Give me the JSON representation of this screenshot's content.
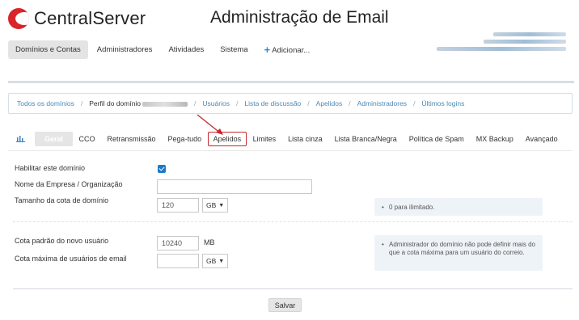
{
  "header": {
    "logo_text": "CentralServer",
    "page_title": "Administração de Email"
  },
  "topnav": {
    "items": [
      {
        "label": "Domínios e Contas",
        "active": true
      },
      {
        "label": "Administradores"
      },
      {
        "label": "Atividades"
      },
      {
        "label": "Sistema"
      },
      {
        "label": "Adicionar...",
        "icon": "plus-icon"
      }
    ]
  },
  "breadcrumb": {
    "items": [
      "Todos os domínios",
      "Perfil do domínio",
      "Usuários",
      "Lista de discussão",
      "Apelidos",
      "Administradores",
      "Últimos logins"
    ]
  },
  "tabs": {
    "chart_icon": "bar-chart-icon",
    "items": [
      "Geral",
      "CCO",
      "Retransmissão",
      "Pega-tudo",
      "Apelidos",
      "Limites",
      "Lista cinza",
      "Lista Branca/Negra",
      "Política de Spam",
      "MX Backup",
      "Avançado"
    ],
    "active": "Geral",
    "highlighted": "Apelidos"
  },
  "form": {
    "enable_label": "Habilitar este domínio",
    "enable_checked": true,
    "company_label": "Nome da Empresa / Organização",
    "company_value": "",
    "quota_label": "Tamanho da cota de domínio",
    "quota_value": "120",
    "quota_unit": "GB",
    "quota_hint": "0 para ilimitado.",
    "default_quota_label": "Cota padrão do novo usuário",
    "default_quota_value": "10240",
    "default_quota_unit": "MB",
    "max_quota_label": "Cota máxima de usuários de email",
    "max_quota_value": "",
    "max_quota_unit": "GB",
    "max_quota_hint": "Administrador do domínio não pode definir mais do que a cota máxima para um usuário do correio."
  },
  "actions": {
    "save_label": "Salvar"
  },
  "colors": {
    "brand_red": "#d9242b",
    "link_blue": "#4a8ab8",
    "annotation_red": "#c8262b"
  }
}
